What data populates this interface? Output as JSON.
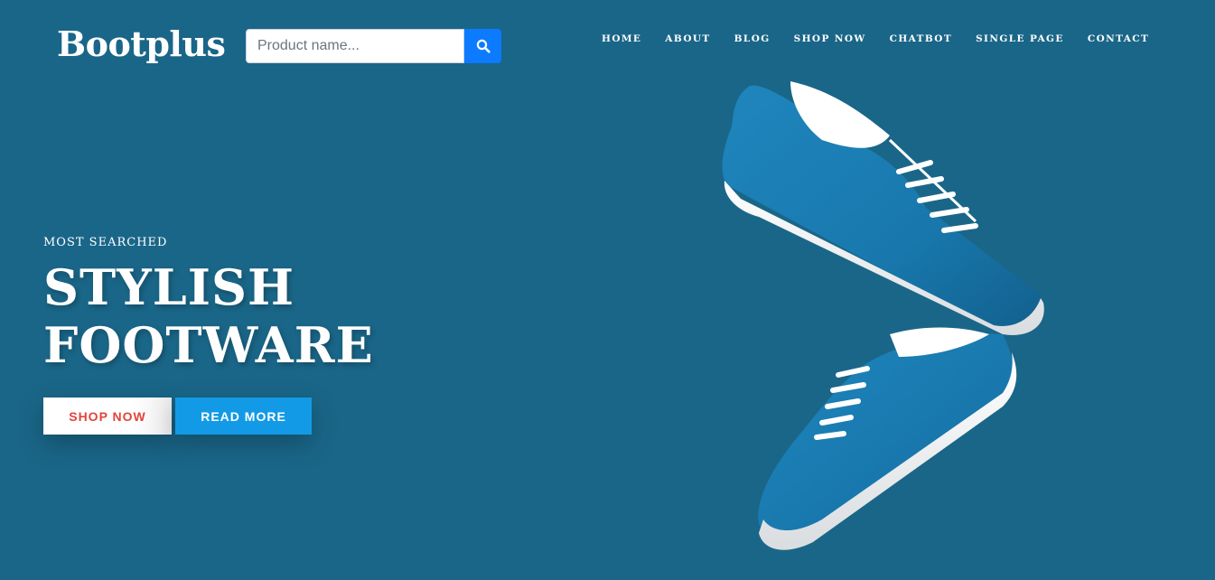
{
  "brand": {
    "logo_text": "Bootplus"
  },
  "search": {
    "placeholder": "Product name...",
    "value": "",
    "button_icon": "search-icon",
    "button_color": "#0d7bff"
  },
  "nav": {
    "items": [
      "HOME",
      "ABOUT",
      "BLOG",
      "SHOP NOW",
      "CHATBOT",
      "SINGLE PAGE",
      "CONTACT"
    ]
  },
  "hero": {
    "kicker": "MOST SEARCHED",
    "title_line1": "STYLISH",
    "title_line2": "FOOTWARE",
    "primary_button": "SHOP NOW",
    "secondary_button": "READ MORE",
    "image": "blue-sneakers-pair"
  },
  "colors": {
    "background": "#1a6688",
    "shop_text": "#e1443b",
    "read_more_bg": "#139ae6",
    "shoe_blue": "#1878ad"
  }
}
